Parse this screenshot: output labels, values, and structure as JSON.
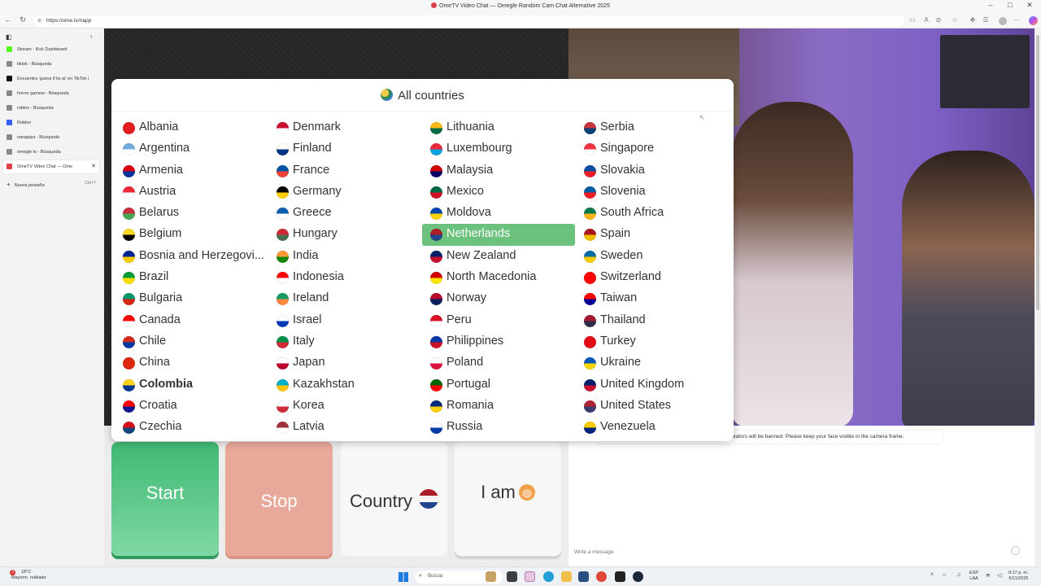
{
  "window": {
    "title": "OmeTV Video Chat — Omegle Random Cam Chat Alternative 2025",
    "controls": [
      "–",
      "□",
      "✕"
    ]
  },
  "addressbar": {
    "url": "https://ome.tv/#app"
  },
  "sidebar": {
    "tabs": [
      {
        "label": "Stream - Kick Dashboard",
        "icon": "kick-icon",
        "color": "#53fc18"
      },
      {
        "label": "tiktok - Búsqueda",
        "icon": "search-icon",
        "color": "#888888"
      },
      {
        "label": "Encuentra 'guess if its ai' en TikTok |",
        "icon": "tiktok-icon",
        "color": "#111111"
      },
      {
        "label": "horror gamew - Búsqueda",
        "icon": "search-icon",
        "color": "#888888"
      },
      {
        "label": "roblox - Búsqueda",
        "icon": "search-icon",
        "color": "#888888"
      },
      {
        "label": "Roblox",
        "icon": "roblox-icon",
        "color": "#335fff"
      },
      {
        "label": "nanapips - Búsqueda",
        "icon": "search-icon",
        "color": "#888888"
      },
      {
        "label": "omegle tv - Búsqueda",
        "icon": "search-icon",
        "color": "#888888"
      },
      {
        "label": "OmeTV Video Chat — Ome",
        "icon": "ometv-icon",
        "color": "#e0404a"
      }
    ],
    "new_tab_label": "Nueva pestaña",
    "new_tab_shortcut": "Ctrl+T"
  },
  "modal": {
    "title": "All countries",
    "selected": "Netherlands",
    "columns": [
      [
        {
          "name": "Albania",
          "colors": [
            "#e41e20",
            "#e41e20"
          ]
        },
        {
          "name": "Argentina",
          "colors": [
            "#74acdf",
            "#ffffff"
          ]
        },
        {
          "name": "Armenia",
          "colors": [
            "#d90012",
            "#0033a0"
          ]
        },
        {
          "name": "Austria",
          "colors": [
            "#ed2939",
            "#ffffff"
          ]
        },
        {
          "name": "Belarus",
          "colors": [
            "#c8313e",
            "#4aa657"
          ]
        },
        {
          "name": "Belgium",
          "colors": [
            "#fdda24",
            "#000000"
          ]
        },
        {
          "name": "Bosnia and Herzegovi...",
          "colors": [
            "#002395",
            "#fecb00"
          ]
        },
        {
          "name": "Brazil",
          "colors": [
            "#009b3a",
            "#fedf00"
          ]
        },
        {
          "name": "Bulgaria",
          "colors": [
            "#00966e",
            "#d62612"
          ]
        },
        {
          "name": "Canada",
          "colors": [
            "#ff0000",
            "#ffffff"
          ]
        },
        {
          "name": "Chile",
          "colors": [
            "#d52b1e",
            "#0039a6"
          ]
        },
        {
          "name": "China",
          "colors": [
            "#de2910",
            "#de2910"
          ]
        },
        {
          "name": "Colombia",
          "colors": [
            "#fcd116",
            "#003893"
          ],
          "bold": true
        },
        {
          "name": "Croatia",
          "colors": [
            "#ff0000",
            "#171796"
          ]
        },
        {
          "name": "Czechia",
          "colors": [
            "#d7141a",
            "#11457e"
          ]
        }
      ],
      [
        {
          "name": "Denmark",
          "colors": [
            "#c8102e",
            "#ffffff"
          ]
        },
        {
          "name": "Finland",
          "colors": [
            "#ffffff",
            "#003580"
          ]
        },
        {
          "name": "France",
          "colors": [
            "#0055a4",
            "#ef4135"
          ]
        },
        {
          "name": "Germany",
          "colors": [
            "#000000",
            "#ffce00"
          ]
        },
        {
          "name": "Greece",
          "colors": [
            "#0d5eaf",
            "#ffffff"
          ]
        },
        {
          "name": "Hungary",
          "colors": [
            "#ce2939",
            "#477050"
          ]
        },
        {
          "name": "India",
          "colors": [
            "#ff9933",
            "#138808"
          ]
        },
        {
          "name": "Indonesia",
          "colors": [
            "#ff0000",
            "#ffffff"
          ]
        },
        {
          "name": "Ireland",
          "colors": [
            "#169b62",
            "#ff883e"
          ]
        },
        {
          "name": "Israel",
          "colors": [
            "#ffffff",
            "#0038b8"
          ]
        },
        {
          "name": "Italy",
          "colors": [
            "#009246",
            "#ce2b37"
          ]
        },
        {
          "name": "Japan",
          "colors": [
            "#ffffff",
            "#bc002d"
          ]
        },
        {
          "name": "Kazakhstan",
          "colors": [
            "#00afca",
            "#fec50c"
          ]
        },
        {
          "name": "Korea",
          "colors": [
            "#ffffff",
            "#cd2e3a"
          ]
        },
        {
          "name": "Latvia",
          "colors": [
            "#9e3039",
            "#ffffff"
          ]
        }
      ],
      [
        {
          "name": "Lithuania",
          "colors": [
            "#fdb913",
            "#006a44"
          ]
        },
        {
          "name": "Luxembourg",
          "colors": [
            "#ed2939",
            "#00a1de"
          ]
        },
        {
          "name": "Malaysia",
          "colors": [
            "#cc0001",
            "#010066"
          ]
        },
        {
          "name": "Mexico",
          "colors": [
            "#006847",
            "#ce1126"
          ]
        },
        {
          "name": "Moldova",
          "colors": [
            "#0046ae",
            "#ffd200"
          ]
        },
        {
          "name": "Netherlands",
          "colors": [
            "#ae1c28",
            "#21468b"
          ]
        },
        {
          "name": "New Zealand",
          "colors": [
            "#012169",
            "#c8102e"
          ]
        },
        {
          "name": "North Macedonia",
          "colors": [
            "#d20000",
            "#ffe600"
          ]
        },
        {
          "name": "Norway",
          "colors": [
            "#ba0c2f",
            "#00205b"
          ]
        },
        {
          "name": "Peru",
          "colors": [
            "#d91023",
            "#ffffff"
          ]
        },
        {
          "name": "Philippines",
          "colors": [
            "#0038a8",
            "#ce1126"
          ]
        },
        {
          "name": "Poland",
          "colors": [
            "#ffffff",
            "#dc143c"
          ]
        },
        {
          "name": "Portugal",
          "colors": [
            "#006600",
            "#ff0000"
          ]
        },
        {
          "name": "Romania",
          "colors": [
            "#002b7f",
            "#fcd116"
          ]
        },
        {
          "name": "Russia",
          "colors": [
            "#ffffff",
            "#0039a6"
          ]
        }
      ],
      [
        {
          "name": "Serbia",
          "colors": [
            "#c6363c",
            "#0c4076"
          ]
        },
        {
          "name": "Singapore",
          "colors": [
            "#ef3340",
            "#ffffff"
          ]
        },
        {
          "name": "Slovakia",
          "colors": [
            "#0b4ea2",
            "#ee1c25"
          ]
        },
        {
          "name": "Slovenia",
          "colors": [
            "#005da4",
            "#ed1c24"
          ]
        },
        {
          "name": "South Africa",
          "colors": [
            "#007a4d",
            "#ffb612"
          ]
        },
        {
          "name": "Spain",
          "colors": [
            "#aa151b",
            "#f1bf00"
          ]
        },
        {
          "name": "Sweden",
          "colors": [
            "#006aa7",
            "#fecc00"
          ]
        },
        {
          "name": "Switzerland",
          "colors": [
            "#ff0000",
            "#ff0000"
          ]
        },
        {
          "name": "Taiwan",
          "colors": [
            "#fe0000",
            "#000095"
          ]
        },
        {
          "name": "Thailand",
          "colors": [
            "#a51931",
            "#2d2a4a"
          ]
        },
        {
          "name": "Turkey",
          "colors": [
            "#e30a17",
            "#e30a17"
          ]
        },
        {
          "name": "Ukraine",
          "colors": [
            "#0057b7",
            "#ffd700"
          ]
        },
        {
          "name": "United Kingdom",
          "colors": [
            "#012169",
            "#c8102e"
          ]
        },
        {
          "name": "United States",
          "colors": [
            "#b22234",
            "#3c3b6e"
          ]
        },
        {
          "name": "Venezuela",
          "colors": [
            "#ffcc00",
            "#00247d"
          ]
        }
      ]
    ]
  },
  "controls": {
    "start_label": "Start",
    "stop_label": "Stop",
    "country_label": "Country",
    "iam_label": "I am"
  },
  "chat": {
    "notice": "iolators will be banned. Please keep your face visible in the camera frame.",
    "placeholder": "Write a message"
  },
  "taskbar": {
    "weather_temp": "18°C",
    "weather_desc": "Mayorm. nublado",
    "weather_badge": "3",
    "search_placeholder": "Buscar",
    "lang_1": "ESP",
    "lang_2": "LAA",
    "time": "9:17 p. m.",
    "date": "5/11/2025"
  }
}
